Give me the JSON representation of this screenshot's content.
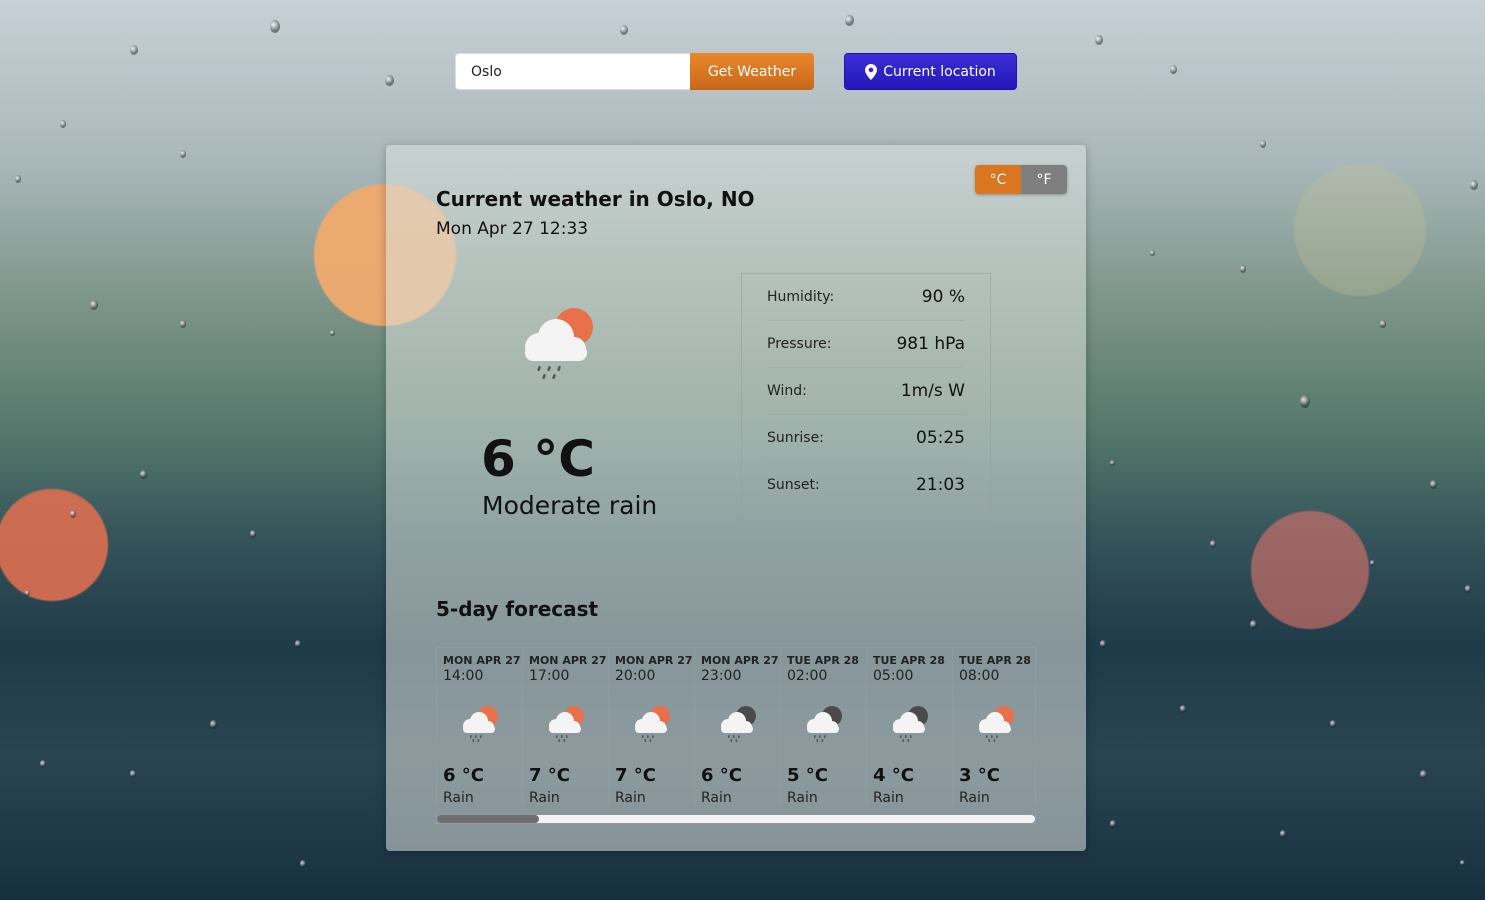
{
  "search": {
    "value": "Oslo",
    "button_label": "Get Weather"
  },
  "location_button": {
    "label": "Current location"
  },
  "units": {
    "celsius": "°C",
    "fahrenheit": "°F",
    "selected": "°C"
  },
  "current": {
    "title": "Current weather in Oslo, NO",
    "date": "Mon Apr 27 12:33",
    "icon": "cloud-rain-sun-icon",
    "temperature": "6 °C",
    "description": "Moderate rain"
  },
  "details": [
    {
      "label": "Humidity:",
      "value": "90 %"
    },
    {
      "label": "Pressure:",
      "value": "981 hPa"
    },
    {
      "label": "Wind:",
      "value": "1m/s W"
    },
    {
      "label": "Sunrise:",
      "value": "05:25"
    },
    {
      "label": "Sunset:",
      "value": "21:03"
    }
  ],
  "forecast": {
    "title": "5-day forecast",
    "items": [
      {
        "day": "MON APR 27",
        "time": "14:00",
        "icon": "cloud-rain-sun-icon",
        "temp": "6 °C",
        "desc": "Rain"
      },
      {
        "day": "MON APR 27",
        "time": "17:00",
        "icon": "cloud-rain-sun-icon",
        "temp": "7 °C",
        "desc": "Rain"
      },
      {
        "day": "MON APR 27",
        "time": "20:00",
        "icon": "cloud-rain-sun-icon",
        "temp": "7 °C",
        "desc": "Rain"
      },
      {
        "day": "MON APR 27",
        "time": "23:00",
        "icon": "cloud-rain-moon-icon",
        "temp": "6 °C",
        "desc": "Rain"
      },
      {
        "day": "TUE APR 28",
        "time": "02:00",
        "icon": "cloud-rain-moon-icon",
        "temp": "5 °C",
        "desc": "Rain"
      },
      {
        "day": "TUE APR 28",
        "time": "05:00",
        "icon": "cloud-rain-moon-icon",
        "temp": "4 °C",
        "desc": "Rain"
      },
      {
        "day": "TUE APR 28",
        "time": "08:00",
        "icon": "cloud-rain-sun-icon",
        "temp": "3 °C",
        "desc": "Rain"
      }
    ],
    "scroll_position": 0.17
  },
  "colors": {
    "get_weather_button": "#d9761f",
    "location_button": "#2a1fc6",
    "celsius_active": "#d9761f",
    "fahrenheit_inactive": "#7e7e7e",
    "sun": "#e8704a",
    "moon": "#4a4a4a"
  }
}
